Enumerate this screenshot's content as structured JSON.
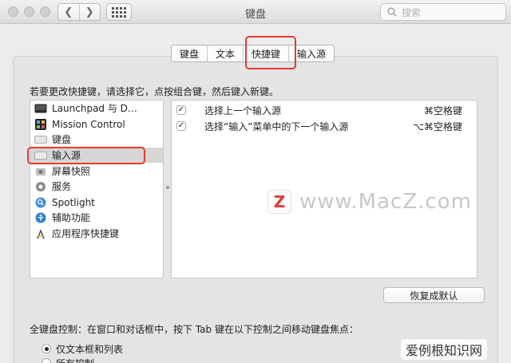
{
  "window": {
    "title": "键盘"
  },
  "search": {
    "placeholder": "搜索"
  },
  "tabs": [
    {
      "label": "键盘"
    },
    {
      "label": "文本"
    },
    {
      "label": "快捷键",
      "active": true
    },
    {
      "label": "输入源"
    }
  ],
  "instruction": "若要更改快捷键，请选择它，点按组合键，然后键入新键。",
  "categories": [
    {
      "label": "Launchpad 与 D…",
      "icon": "launchpad-icon"
    },
    {
      "label": "Mission Control",
      "icon": "mission-control-icon"
    },
    {
      "label": "键盘",
      "icon": "keyboard-icon"
    },
    {
      "label": "输入源",
      "icon": "input-source-icon",
      "selected": true
    },
    {
      "label": "屏幕快照",
      "icon": "screenshot-icon"
    },
    {
      "label": "服务",
      "icon": "services-gear-icon"
    },
    {
      "label": "Spotlight",
      "icon": "spotlight-icon"
    },
    {
      "label": "辅助功能",
      "icon": "accessibility-icon"
    },
    {
      "label": "应用程序快捷键",
      "icon": "app-shortcuts-icon"
    }
  ],
  "shortcuts": [
    {
      "checked": true,
      "check_mark": "✓",
      "label": "选择上一个输入源",
      "keys": "⌘空格键"
    },
    {
      "checked": true,
      "check_mark": "✓",
      "label": "选择“输入”菜单中的下一个输入源",
      "keys": "⌥⌘空格键"
    }
  ],
  "restore_button": "恢复成默认",
  "keyboard_control": {
    "label": "全键盘控制：在窗口和对话框中，按下 Tab 键在以下控制之间移动键盘焦点：",
    "options": [
      {
        "label": "仅文本框和列表",
        "selected": true
      },
      {
        "label": "所有控制",
        "selected": false
      }
    ]
  },
  "watermark": {
    "logo": "Z",
    "text": "www.MacZ.com"
  },
  "corner_watermark": "爱例根知识网",
  "colors": {
    "highlight": "#e53935",
    "accent": "#e53935"
  }
}
